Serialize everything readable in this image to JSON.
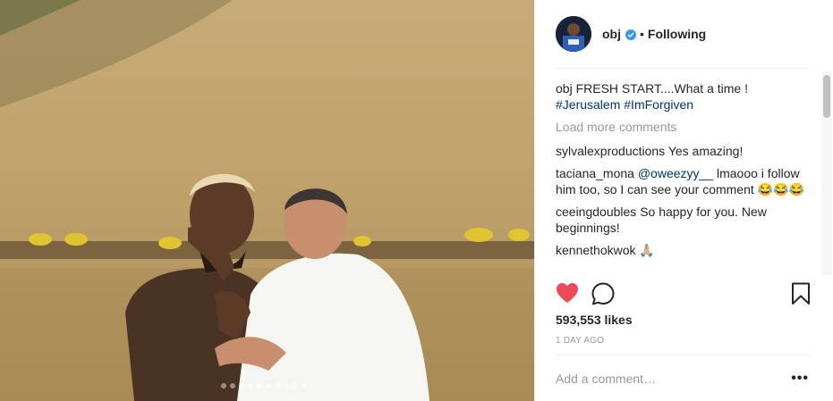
{
  "header": {
    "username": "obj",
    "separator": "•",
    "follow_label": "Following"
  },
  "comments": [
    {
      "user": "obj",
      "text": "FRESH START....What a time !",
      "tags": [
        "#Jerusalem",
        "#ImForgiven"
      ]
    },
    {
      "load_more": "Load more comments"
    },
    {
      "user": "sylvalexproductions",
      "text": "Yes amazing!"
    },
    {
      "user": "taciana_mona",
      "mention": "@oweezyy__",
      "text": "lmaooo i follow him too, so I can see your comment 😂😂😂"
    },
    {
      "user": "ceeingdoubles",
      "text": "So happy for you. New beginnings!"
    },
    {
      "user": "kennethokwok",
      "text": "🙏🏼"
    }
  ],
  "likes": "593,553 likes",
  "timestamp": "1 DAY AGO",
  "add_comment_placeholder": "Add a comment…",
  "more_options": "•••",
  "carousel": {
    "count": 10,
    "active_index": 4
  },
  "colors": {
    "heart": "#ed4956",
    "verified": "#3897f0",
    "hashtag": "#003569",
    "muted": "#999999"
  },
  "icons": [
    "heart-icon",
    "comment-icon",
    "bookmark-icon",
    "verified-badge-icon",
    "more-options-icon"
  ]
}
